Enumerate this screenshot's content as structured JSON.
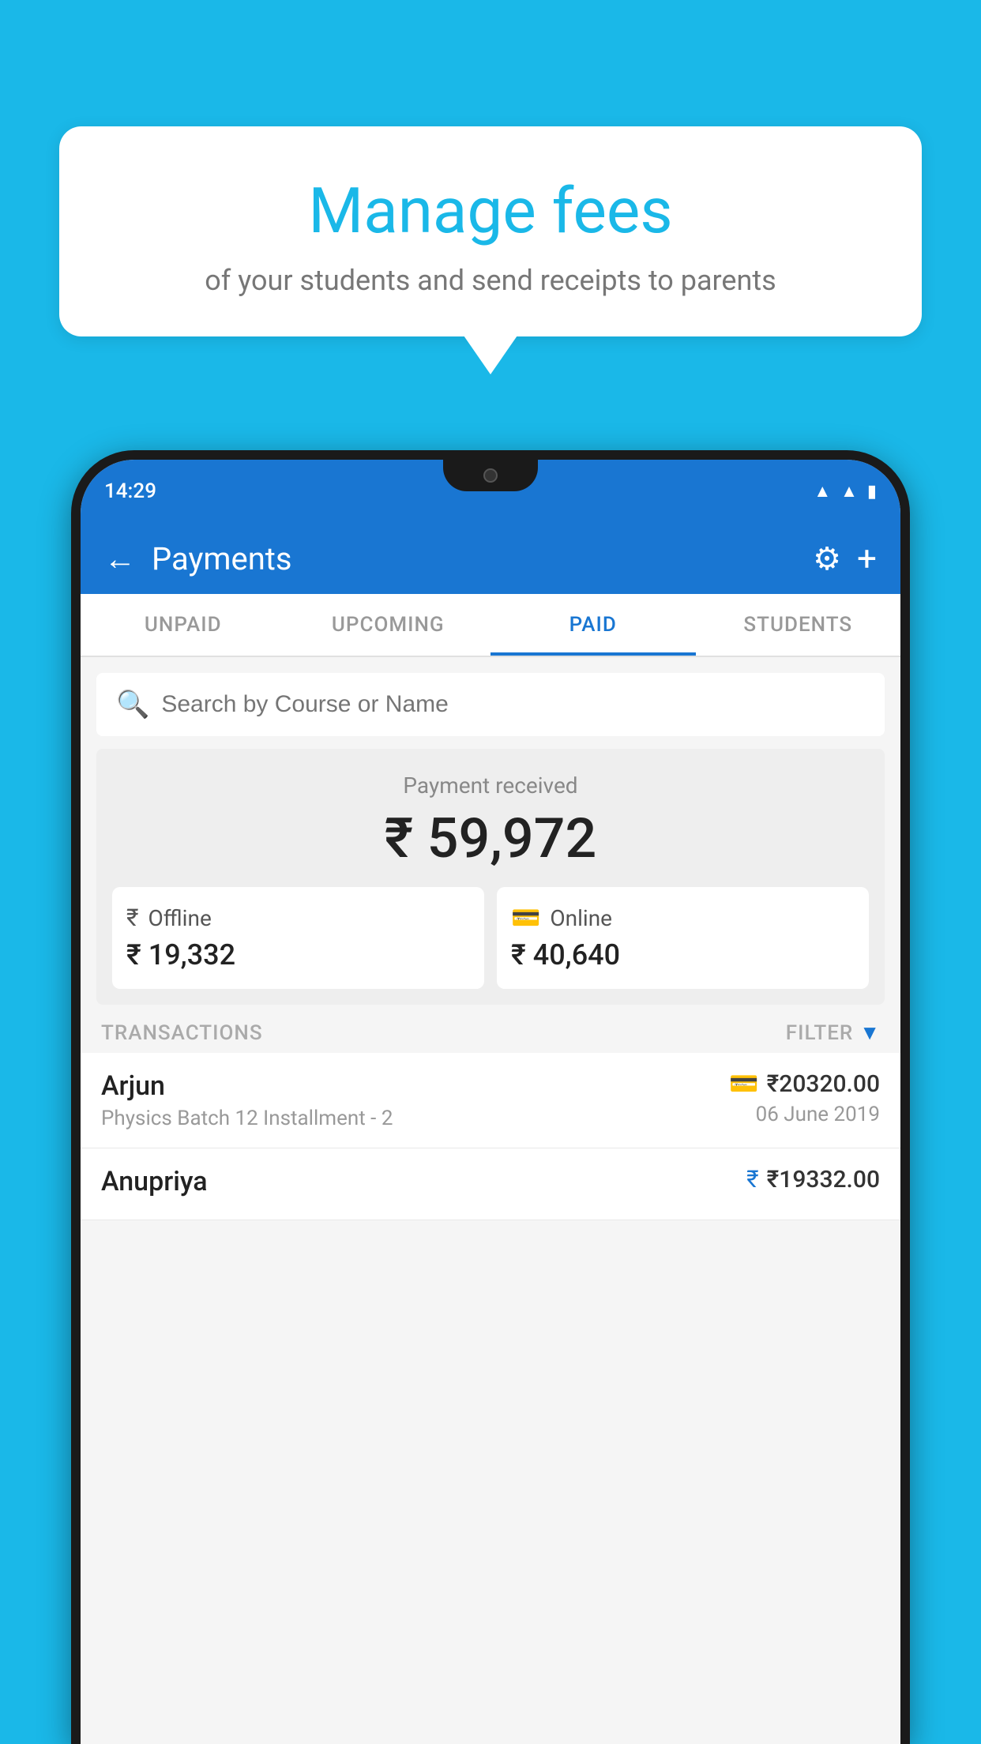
{
  "background_color": "#1ab8e8",
  "speech_bubble": {
    "title": "Manage fees",
    "subtitle": "of your students and send receipts to parents"
  },
  "status_bar": {
    "time": "14:29",
    "wifi_icon": "wifi",
    "signal_icon": "signal",
    "battery_icon": "battery"
  },
  "header": {
    "title": "Payments",
    "back_label": "←",
    "gear_label": "⚙",
    "plus_label": "+"
  },
  "tabs": [
    {
      "label": "UNPAID",
      "active": false
    },
    {
      "label": "UPCOMING",
      "active": false
    },
    {
      "label": "PAID",
      "active": true
    },
    {
      "label": "STUDENTS",
      "active": false
    }
  ],
  "search": {
    "placeholder": "Search by Course or Name",
    "icon": "🔍"
  },
  "payment_received": {
    "label": "Payment received",
    "amount": "₹ 59,972",
    "offline": {
      "type": "Offline",
      "amount": "₹ 19,332"
    },
    "online": {
      "type": "Online",
      "amount": "₹ 40,640"
    }
  },
  "transactions": {
    "label": "TRANSACTIONS",
    "filter_label": "FILTER",
    "items": [
      {
        "name": "Arjun",
        "description": "Physics Batch 12 Installment - 2",
        "amount": "₹20320.00",
        "date": "06 June 2019",
        "payment_type": "card"
      },
      {
        "name": "Anupriya",
        "description": "",
        "amount": "₹19332.00",
        "date": "",
        "payment_type": "cash"
      }
    ]
  }
}
